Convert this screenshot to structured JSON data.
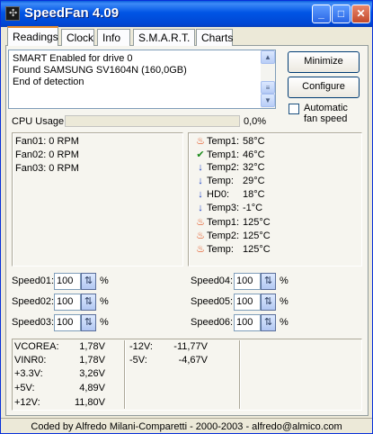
{
  "window": {
    "title": "SpeedFan 4.09",
    "app_icon": "fan-icon"
  },
  "tabs": [
    "Readings",
    "Clock",
    "Info",
    "S.M.A.R.T.",
    "Charts"
  ],
  "active_tab": "Readings",
  "log": {
    "lines": [
      "SMART Enabled for drive 0",
      "Found SAMSUNG SV1604N (160,0GB)",
      "End of detection"
    ]
  },
  "buttons": {
    "minimize": "Minimize",
    "configure": "Configure"
  },
  "auto_speed": {
    "label": "Automatic fan speed",
    "checked": false
  },
  "cpu": {
    "label": "CPU Usage",
    "value": "0,0%",
    "fraction": 0.0
  },
  "fans": [
    "Fan01: 0 RPM",
    "Fan02: 0 RPM",
    "Fan03: 0 RPM"
  ],
  "temps": [
    {
      "name": "Temp1:",
      "value": "58°C",
      "icon": "flame-icon"
    },
    {
      "name": "Temp1:",
      "value": "46°C",
      "icon": "check-icon"
    },
    {
      "name": "Temp2:",
      "value": "32°C",
      "icon": "arrow-down-icon"
    },
    {
      "name": "Temp:",
      "value": "29°C",
      "icon": "arrow-down-icon"
    },
    {
      "name": "HD0:",
      "value": "18°C",
      "icon": "arrow-down-icon"
    },
    {
      "name": "Temp3:",
      "value": "-1°C",
      "icon": "arrow-down-icon"
    },
    {
      "name": "Temp1:",
      "value": "125°C",
      "icon": "flame-icon"
    },
    {
      "name": "Temp2:",
      "value": "125°C",
      "icon": "flame-icon"
    },
    {
      "name": "Temp:",
      "value": "125°C",
      "icon": "flame-icon"
    }
  ],
  "speeds": [
    {
      "label": "Speed01:",
      "value": "100"
    },
    {
      "label": "Speed02:",
      "value": "100"
    },
    {
      "label": "Speed03:",
      "value": "100"
    },
    {
      "label": "Speed04:",
      "value": "100"
    },
    {
      "label": "Speed05:",
      "value": "100"
    },
    {
      "label": "Speed06:",
      "value": "100"
    }
  ],
  "speed_unit": "%",
  "voltages_left": [
    {
      "name": "VCOREA:",
      "value": "1,78V"
    },
    {
      "name": "VINR0:",
      "value": "1,78V"
    },
    {
      "name": "+3.3V:",
      "value": "3,26V"
    },
    {
      "name": "+5V:",
      "value": "4,89V"
    },
    {
      "name": "+12V:",
      "value": "11,80V"
    }
  ],
  "voltages_mid": [
    {
      "name": "-12V:",
      "value": "-11,77V"
    },
    {
      "name": "-5V:",
      "value": "-4,67V"
    }
  ],
  "status": "Coded by Alfredo Milani-Comparetti - 2000-2003 - alfredo@almico.com",
  "colors": {
    "title_bar": "#0055e5",
    "window_bg": "#ece9d8",
    "flame": "#e0420a",
    "check": "#1a8a1a",
    "arrow": "#1b3fc4"
  }
}
